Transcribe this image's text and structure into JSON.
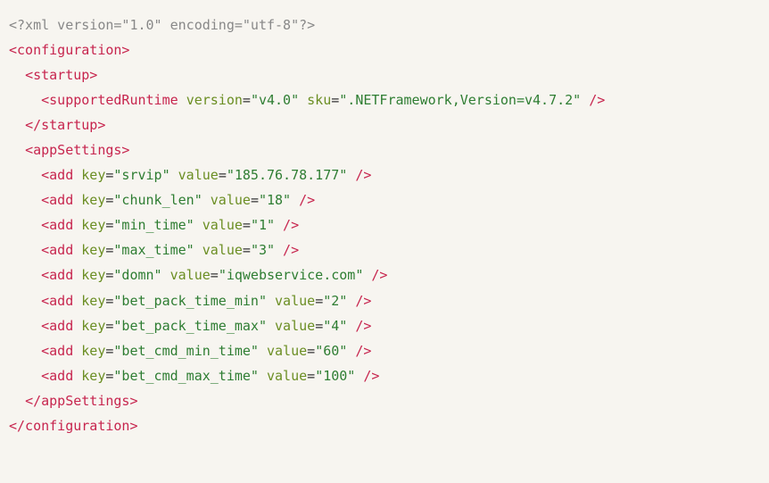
{
  "lines": [
    {
      "type": "pi",
      "indent": 0,
      "tokens": [
        {
          "kind": "pi",
          "text": "<?xml version=\"1.0\" encoding=\"utf-8\"?>"
        }
      ]
    },
    {
      "type": "open",
      "indent": 0,
      "tokens": [
        {
          "kind": "tag",
          "text": "<configuration>"
        }
      ]
    },
    {
      "type": "open",
      "indent": 2,
      "tokens": [
        {
          "kind": "tag",
          "text": "<startup>"
        }
      ]
    },
    {
      "type": "self",
      "indent": 4,
      "tokens": [
        {
          "kind": "tag",
          "text": "<supportedRuntime "
        },
        {
          "kind": "attr-name",
          "text": "version"
        },
        {
          "kind": "attr-eq",
          "text": "="
        },
        {
          "kind": "attr-value",
          "text": "\"v4.0\""
        },
        {
          "kind": "attr-name",
          "text": " sku"
        },
        {
          "kind": "attr-eq",
          "text": "="
        },
        {
          "kind": "attr-value",
          "text": "\".NETFramework,Version=v4.7.2\""
        },
        {
          "kind": "tag",
          "text": " />"
        }
      ]
    },
    {
      "type": "close",
      "indent": 2,
      "tokens": [
        {
          "kind": "tag",
          "text": "</startup>"
        }
      ]
    },
    {
      "type": "open",
      "indent": 2,
      "tokens": [
        {
          "kind": "tag",
          "text": "<appSettings>"
        }
      ]
    },
    {
      "type": "self",
      "indent": 4,
      "tokens": [
        {
          "kind": "tag",
          "text": "<add "
        },
        {
          "kind": "attr-name",
          "text": "key"
        },
        {
          "kind": "attr-eq",
          "text": "="
        },
        {
          "kind": "attr-value",
          "text": "\"srvip\""
        },
        {
          "kind": "attr-name",
          "text": " value"
        },
        {
          "kind": "attr-eq",
          "text": "="
        },
        {
          "kind": "attr-value",
          "text": "\"185.76.78.177\""
        },
        {
          "kind": "tag",
          "text": " />"
        }
      ]
    },
    {
      "type": "self",
      "indent": 4,
      "tokens": [
        {
          "kind": "tag",
          "text": "<add "
        },
        {
          "kind": "attr-name",
          "text": "key"
        },
        {
          "kind": "attr-eq",
          "text": "="
        },
        {
          "kind": "attr-value",
          "text": "\"chunk_len\""
        },
        {
          "kind": "attr-name",
          "text": " value"
        },
        {
          "kind": "attr-eq",
          "text": "="
        },
        {
          "kind": "attr-value",
          "text": "\"18\""
        },
        {
          "kind": "tag",
          "text": " />"
        }
      ]
    },
    {
      "type": "self",
      "indent": 4,
      "tokens": [
        {
          "kind": "tag",
          "text": "<add "
        },
        {
          "kind": "attr-name",
          "text": "key"
        },
        {
          "kind": "attr-eq",
          "text": "="
        },
        {
          "kind": "attr-value",
          "text": "\"min_time\""
        },
        {
          "kind": "attr-name",
          "text": " value"
        },
        {
          "kind": "attr-eq",
          "text": "="
        },
        {
          "kind": "attr-value",
          "text": "\"1\""
        },
        {
          "kind": "tag",
          "text": " />"
        }
      ]
    },
    {
      "type": "self",
      "indent": 4,
      "tokens": [
        {
          "kind": "tag",
          "text": "<add "
        },
        {
          "kind": "attr-name",
          "text": "key"
        },
        {
          "kind": "attr-eq",
          "text": "="
        },
        {
          "kind": "attr-value",
          "text": "\"max_time\""
        },
        {
          "kind": "attr-name",
          "text": " value"
        },
        {
          "kind": "attr-eq",
          "text": "="
        },
        {
          "kind": "attr-value",
          "text": "\"3\""
        },
        {
          "kind": "tag",
          "text": " />"
        }
      ]
    },
    {
      "type": "self",
      "indent": 4,
      "tokens": [
        {
          "kind": "tag",
          "text": "<add "
        },
        {
          "kind": "attr-name",
          "text": "key"
        },
        {
          "kind": "attr-eq",
          "text": "="
        },
        {
          "kind": "attr-value",
          "text": "\"domn\""
        },
        {
          "kind": "attr-name",
          "text": " value"
        },
        {
          "kind": "attr-eq",
          "text": "="
        },
        {
          "kind": "attr-value",
          "text": "\"iqwebservice.com\""
        },
        {
          "kind": "tag",
          "text": " />"
        }
      ]
    },
    {
      "type": "self",
      "indent": 4,
      "tokens": [
        {
          "kind": "tag",
          "text": "<add "
        },
        {
          "kind": "attr-name",
          "text": "key"
        },
        {
          "kind": "attr-eq",
          "text": "="
        },
        {
          "kind": "attr-value",
          "text": "\"bet_pack_time_min\""
        },
        {
          "kind": "attr-name",
          "text": " value"
        },
        {
          "kind": "attr-eq",
          "text": "="
        },
        {
          "kind": "attr-value",
          "text": "\"2\""
        },
        {
          "kind": "tag",
          "text": " />"
        }
      ]
    },
    {
      "type": "self",
      "indent": 4,
      "tokens": [
        {
          "kind": "tag",
          "text": "<add "
        },
        {
          "kind": "attr-name",
          "text": "key"
        },
        {
          "kind": "attr-eq",
          "text": "="
        },
        {
          "kind": "attr-value",
          "text": "\"bet_pack_time_max\""
        },
        {
          "kind": "attr-name",
          "text": " value"
        },
        {
          "kind": "attr-eq",
          "text": "="
        },
        {
          "kind": "attr-value",
          "text": "\"4\""
        },
        {
          "kind": "tag",
          "text": " />"
        }
      ]
    },
    {
      "type": "self",
      "indent": 4,
      "tokens": [
        {
          "kind": "tag",
          "text": "<add "
        },
        {
          "kind": "attr-name",
          "text": "key"
        },
        {
          "kind": "attr-eq",
          "text": "="
        },
        {
          "kind": "attr-value",
          "text": "\"bet_cmd_min_time\""
        },
        {
          "kind": "attr-name",
          "text": " value"
        },
        {
          "kind": "attr-eq",
          "text": "="
        },
        {
          "kind": "attr-value",
          "text": "\"60\""
        },
        {
          "kind": "tag",
          "text": " />"
        }
      ]
    },
    {
      "type": "self",
      "indent": 4,
      "tokens": [
        {
          "kind": "tag",
          "text": "<add "
        },
        {
          "kind": "attr-name",
          "text": "key"
        },
        {
          "kind": "attr-eq",
          "text": "="
        },
        {
          "kind": "attr-value",
          "text": "\"bet_cmd_max_time\""
        },
        {
          "kind": "attr-name",
          "text": " value"
        },
        {
          "kind": "attr-eq",
          "text": "="
        },
        {
          "kind": "attr-value",
          "text": "\"100\""
        },
        {
          "kind": "tag",
          "text": " />"
        }
      ]
    },
    {
      "type": "close",
      "indent": 2,
      "tokens": [
        {
          "kind": "tag",
          "text": "</appSettings>"
        }
      ]
    },
    {
      "type": "close",
      "indent": 0,
      "tokens": [
        {
          "kind": "tag",
          "text": "</configuration>"
        }
      ]
    }
  ]
}
